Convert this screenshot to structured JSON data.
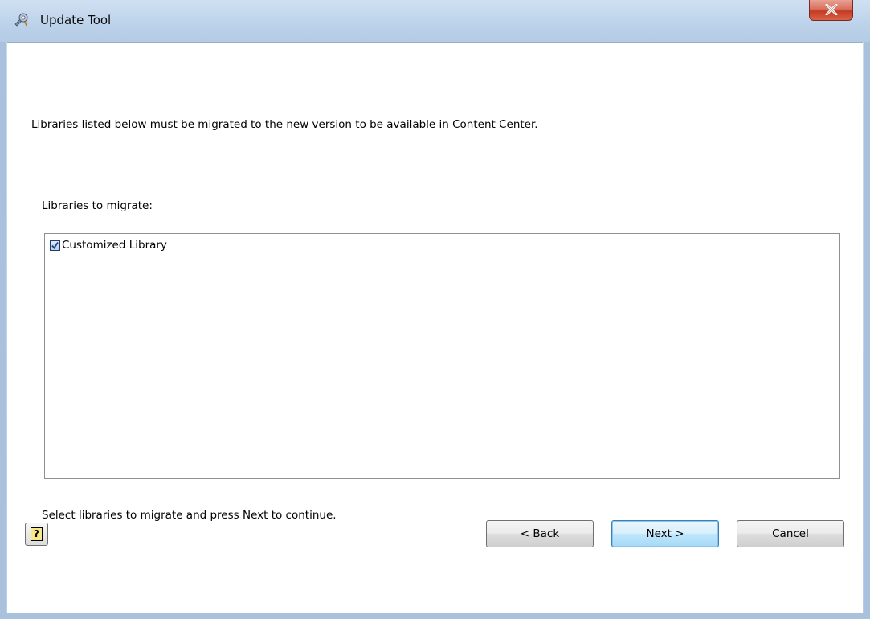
{
  "window": {
    "title": "Update Tool",
    "close_icon": "close-icon",
    "app_icon": "update-tool-icon"
  },
  "content": {
    "intro_text": "Libraries listed below must be migrated to the new version to be available in Content Center.",
    "list_label": "Libraries to migrate:",
    "libraries": [
      {
        "label": "Customized Library",
        "checked": true
      }
    ],
    "hint_text": "Select libraries to migrate and press Next to continue."
  },
  "footer": {
    "help_icon": "help-icon",
    "help_glyph": "?",
    "back_label": "< Back",
    "next_label": "Next >",
    "cancel_label": "Cancel"
  },
  "colors": {
    "frame": "#a9c1dc",
    "close_button": "#c43b22",
    "default_button_border": "#3c7fb1"
  }
}
